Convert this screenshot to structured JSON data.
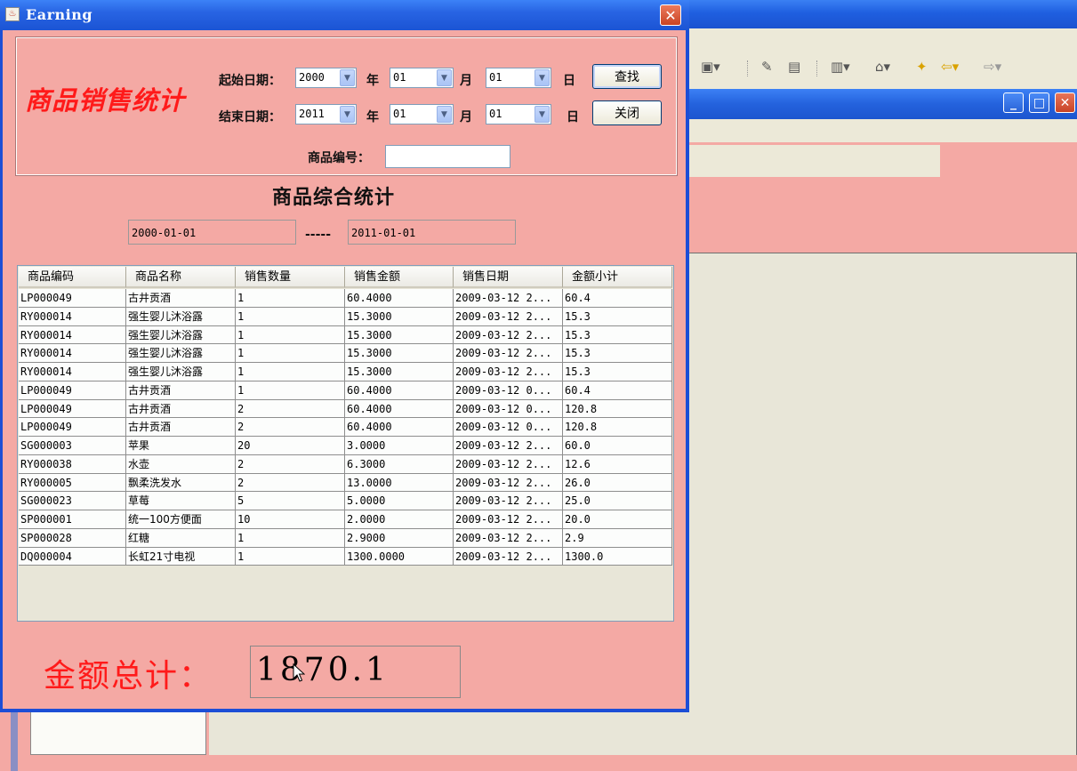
{
  "window": {
    "title": "Earning",
    "close_glyph": "✕"
  },
  "form": {
    "heading": "商品销售统计",
    "start_label": "起始日期：",
    "end_label": "结束日期：",
    "start_year": "2000",
    "start_month": "01",
    "start_day": "01",
    "end_year": "2011",
    "end_month": "01",
    "end_day": "01",
    "year_unit": "年",
    "month_unit": "月",
    "day_unit": "日",
    "search_button": "查找",
    "close_button": "关闭",
    "product_code_label": "商品编号：",
    "product_code_value": ""
  },
  "summary": {
    "title": "商品综合统计",
    "from_date": "2000-01-01",
    "separator": "-----",
    "to_date": "2011-01-01"
  },
  "table": {
    "columns": [
      "商品编码",
      "商品名称",
      "销售数量",
      "销售金额",
      "销售日期",
      "金额小计"
    ],
    "rows": [
      [
        "LP000049",
        "古井贡酒",
        "1",
        "60.4000",
        "2009-03-12 2...",
        "60.4"
      ],
      [
        "RY000014",
        "强生婴儿沐浴露",
        "1",
        "15.3000",
        "2009-03-12 2...",
        "15.3"
      ],
      [
        "RY000014",
        "强生婴儿沐浴露",
        "1",
        "15.3000",
        "2009-03-12 2...",
        "15.3"
      ],
      [
        "RY000014",
        "强生婴儿沐浴露",
        "1",
        "15.3000",
        "2009-03-12 2...",
        "15.3"
      ],
      [
        "RY000014",
        "强生婴儿沐浴露",
        "1",
        "15.3000",
        "2009-03-12 2...",
        "15.3"
      ],
      [
        "LP000049",
        "古井贡酒",
        "1",
        "60.4000",
        "2009-03-12 0...",
        "60.4"
      ],
      [
        "LP000049",
        "古井贡酒",
        "2",
        "60.4000",
        "2009-03-12 0...",
        "120.8"
      ],
      [
        "LP000049",
        "古井贡酒",
        "2",
        "60.4000",
        "2009-03-12 0...",
        "120.8"
      ],
      [
        "SG000003",
        "苹果",
        "20",
        "3.0000",
        "2009-03-12 2...",
        "60.0"
      ],
      [
        "RY000038",
        "水壶",
        "2",
        "6.3000",
        "2009-03-12 2...",
        "12.6"
      ],
      [
        "RY000005",
        "飘柔洗发水",
        "2",
        "13.0000",
        "2009-03-12 2...",
        "26.0"
      ],
      [
        "SG000023",
        "草莓",
        "5",
        "5.0000",
        "2009-03-12 2...",
        "25.0"
      ],
      [
        "SP000001",
        "统一100方便面",
        "10",
        "2.0000",
        "2009-03-12 2...",
        "20.0"
      ],
      [
        "SP000028",
        "红糖",
        "1",
        "2.9000",
        "2009-03-12 2...",
        "2.9"
      ],
      [
        "DQ000004",
        "长虹21寸电视",
        "1",
        "1300.0000",
        "2009-03-12 2...",
        "1300.0"
      ]
    ]
  },
  "total": {
    "label": "金额总计：",
    "value": "1870.1"
  },
  "background_app": {
    "min_glyph": "_",
    "max_glyph": "□",
    "close_glyph": "✕"
  },
  "colors": {
    "panel": "#f4a9a4",
    "heading_red": "#ff1a1a",
    "titlebar_blue": "#2864e3"
  }
}
